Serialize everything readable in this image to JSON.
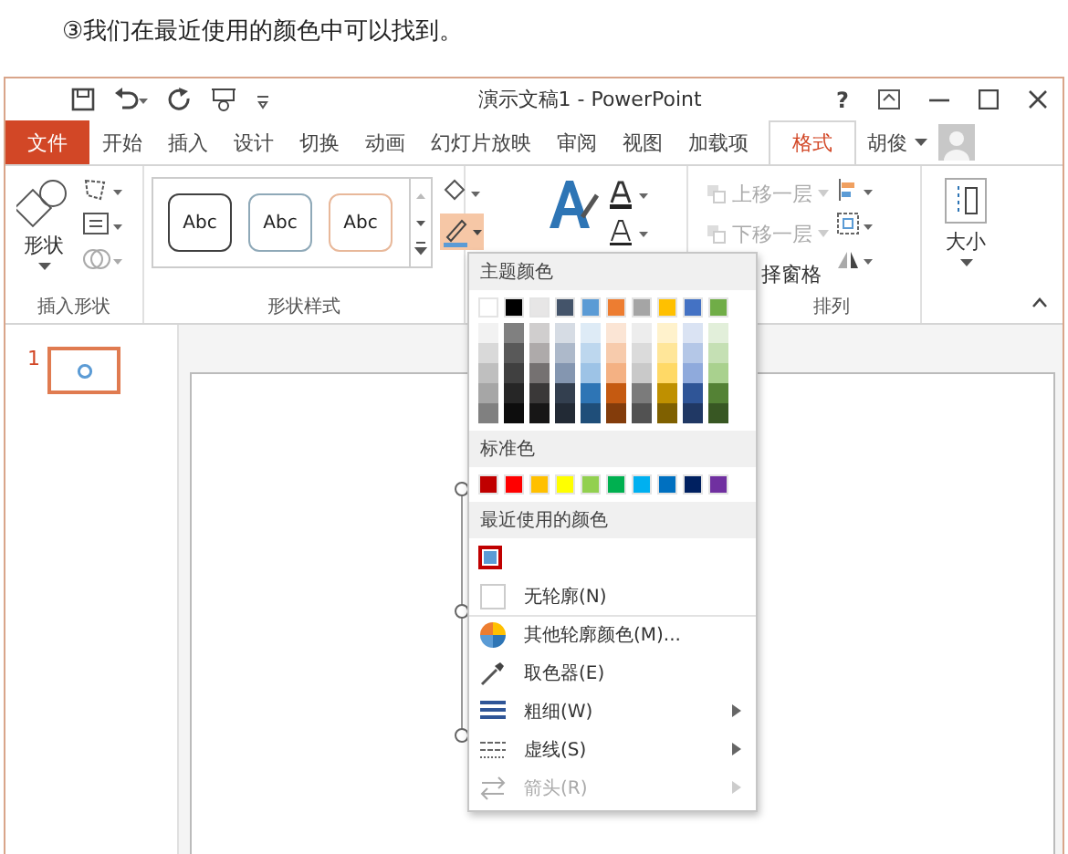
{
  "caption": "③我们在最近使用的颜色中可以找到。",
  "window": {
    "title": "演示文稿1 - PowerPoint",
    "help": "?"
  },
  "tabs": [
    {
      "label": "文件",
      "kind": "file",
      "selected": false
    },
    {
      "label": "开始",
      "kind": "tab",
      "selected": false
    },
    {
      "label": "插入",
      "kind": "tab",
      "selected": false
    },
    {
      "label": "设计",
      "kind": "tab",
      "selected": false
    },
    {
      "label": "切换",
      "kind": "tab",
      "selected": false
    },
    {
      "label": "动画",
      "kind": "tab",
      "selected": false
    },
    {
      "label": "幻灯片放映",
      "kind": "tab",
      "selected": false
    },
    {
      "label": "审阅",
      "kind": "tab",
      "selected": false
    },
    {
      "label": "视图",
      "kind": "tab",
      "selected": false
    },
    {
      "label": "加载项",
      "kind": "tab",
      "selected": false
    },
    {
      "label": "格式",
      "kind": "tab",
      "selected": true
    }
  ],
  "user": {
    "name": "胡俊"
  },
  "ribbon": {
    "insert_shapes": {
      "button": "形状",
      "label": "插入形状"
    },
    "shape_styles": {
      "samples": [
        {
          "text": "Abc",
          "color": "#404040"
        },
        {
          "text": "Abc",
          "color": "#8fa9b8"
        },
        {
          "text": "Abc",
          "color": "#e8b89a"
        }
      ],
      "label": "形状样式"
    },
    "arrange": {
      "items": [
        {
          "label": "上移一层",
          "kind": "full",
          "disabled": true
        },
        {
          "label": "下移一层",
          "kind": "full",
          "disabled": true
        },
        {
          "label": "择窗格",
          "kind": "covered",
          "disabled": false
        }
      ],
      "label": "排列"
    },
    "size": {
      "button": "大小"
    }
  },
  "slides": [
    {
      "number": "1",
      "selected": true
    }
  ],
  "menu": {
    "theme_header": "主题颜色",
    "theme_colors": [
      {
        "color": "#ffffff",
        "shades": [
          {
            "color": "#f2f2f2"
          },
          {
            "color": "#d9d9d9"
          },
          {
            "color": "#bfbfbf"
          },
          {
            "color": "#a6a6a6"
          },
          {
            "color": "#808080"
          }
        ]
      },
      {
        "color": "#000000",
        "shades": [
          {
            "color": "#808080"
          },
          {
            "color": "#595959"
          },
          {
            "color": "#404040"
          },
          {
            "color": "#262626"
          },
          {
            "color": "#0d0d0d"
          }
        ]
      },
      {
        "color": "#e7e6e6",
        "shades": [
          {
            "color": "#d0cece"
          },
          {
            "color": "#aeaaaa"
          },
          {
            "color": "#757171"
          },
          {
            "color": "#3a3838"
          },
          {
            "color": "#171616"
          }
        ]
      },
      {
        "color": "#44546a",
        "shades": [
          {
            "color": "#d6dce4"
          },
          {
            "color": "#adb9ca"
          },
          {
            "color": "#8496b0"
          },
          {
            "color": "#333f4f"
          },
          {
            "color": "#222a35"
          }
        ]
      },
      {
        "color": "#5b9bd5",
        "shades": [
          {
            "color": "#deebf6"
          },
          {
            "color": "#bdd7ee"
          },
          {
            "color": "#9dc3e6"
          },
          {
            "color": "#2e75b5"
          },
          {
            "color": "#1f4e79"
          }
        ]
      },
      {
        "color": "#ed7d31",
        "shades": [
          {
            "color": "#fbe5d5"
          },
          {
            "color": "#f7cbac"
          },
          {
            "color": "#f4b183"
          },
          {
            "color": "#c55a11"
          },
          {
            "color": "#833c0b"
          }
        ]
      },
      {
        "color": "#a5a5a5",
        "shades": [
          {
            "color": "#ededed"
          },
          {
            "color": "#dbdbdb"
          },
          {
            "color": "#c9c9c9"
          },
          {
            "color": "#7b7b7b"
          },
          {
            "color": "#525252"
          }
        ]
      },
      {
        "color": "#ffc000",
        "shades": [
          {
            "color": "#fff2cc"
          },
          {
            "color": "#ffe699"
          },
          {
            "color": "#ffd966"
          },
          {
            "color": "#bf9000"
          },
          {
            "color": "#7f6000"
          }
        ]
      },
      {
        "color": "#4472c4",
        "shades": [
          {
            "color": "#dae3f3"
          },
          {
            "color": "#b4c7e7"
          },
          {
            "color": "#8faadc"
          },
          {
            "color": "#2f5597"
          },
          {
            "color": "#203864"
          }
        ]
      },
      {
        "color": "#70ad47",
        "shades": [
          {
            "color": "#e2efda"
          },
          {
            "color": "#c5e0b4"
          },
          {
            "color": "#a9d18e"
          },
          {
            "color": "#548235"
          },
          {
            "color": "#385723"
          }
        ]
      }
    ],
    "standard_header": "标准色",
    "standard_colors": [
      {
        "color": "#c00000"
      },
      {
        "color": "#ff0000"
      },
      {
        "color": "#ffc000"
      },
      {
        "color": "#ffff00"
      },
      {
        "color": "#92d050"
      },
      {
        "color": "#00b050"
      },
      {
        "color": "#00b0f0"
      },
      {
        "color": "#0070c0"
      },
      {
        "color": "#002060"
      },
      {
        "color": "#7030a0"
      }
    ],
    "recent_header": "最近使用的颜色",
    "recent_colors": [
      {
        "color": "#5b9bd5",
        "selected": true
      }
    ],
    "items": [
      {
        "kind": "none",
        "label": "无轮廓(N)",
        "submenu": false,
        "disabled": false
      },
      {
        "kind": "palette",
        "label": "其他轮廓颜色(M)...",
        "submenu": false,
        "disabled": false
      },
      {
        "kind": "eyedropper",
        "label": "取色器(E)",
        "submenu": false,
        "disabled": false
      },
      {
        "kind": "weight",
        "label": "粗细(W)",
        "submenu": true,
        "disabled": false
      },
      {
        "kind": "dash",
        "label": "虚线(S)",
        "submenu": true,
        "disabled": false
      },
      {
        "kind": "arrow",
        "label": "箭头(R)",
        "submenu": true,
        "disabled": true
      }
    ]
  }
}
